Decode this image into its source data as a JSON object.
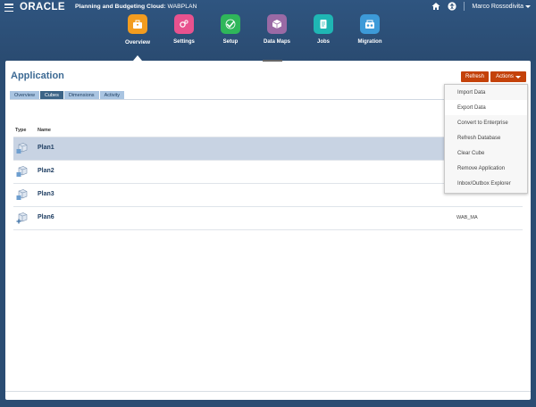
{
  "header": {
    "logo": "ORACLE",
    "app_prefix": "Planning and Budgeting Cloud:",
    "app_name": "WABPLAN",
    "user": "Marco Rossodivita"
  },
  "nav": [
    {
      "label": "Overview",
      "icon": "overview-icon",
      "color": "#f29c1f"
    },
    {
      "label": "Settings",
      "icon": "settings-icon",
      "color": "#e8528e"
    },
    {
      "label": "Setup",
      "icon": "setup-icon",
      "color": "#2fb65a"
    },
    {
      "label": "Data Maps",
      "icon": "data-maps-icon",
      "color": "#9a6aa5"
    },
    {
      "label": "Jobs",
      "icon": "jobs-icon",
      "color": "#1fb6b4"
    },
    {
      "label": "Migration",
      "icon": "migration-icon",
      "color": "#3d9ad8"
    }
  ],
  "page": {
    "title": "Application",
    "refresh": "Refresh",
    "actions": "Actions"
  },
  "tabs": [
    "Overview",
    "Cubes",
    "Dimensions",
    "Activity"
  ],
  "table": {
    "headers": {
      "type": "Type",
      "name": "Name"
    },
    "rows": [
      {
        "name": "Plan1",
        "db": ""
      },
      {
        "name": "Plan2",
        "db": ""
      },
      {
        "name": "Plan3",
        "db": ""
      },
      {
        "name": "Plan6",
        "db": "WAB_MA"
      }
    ]
  },
  "menu": [
    "Import Data",
    "Export Data",
    "Convert to Enterprise",
    "Refresh Database",
    "Clear Cube",
    "Remove Application",
    "Inbox/Outbox Explorer"
  ]
}
